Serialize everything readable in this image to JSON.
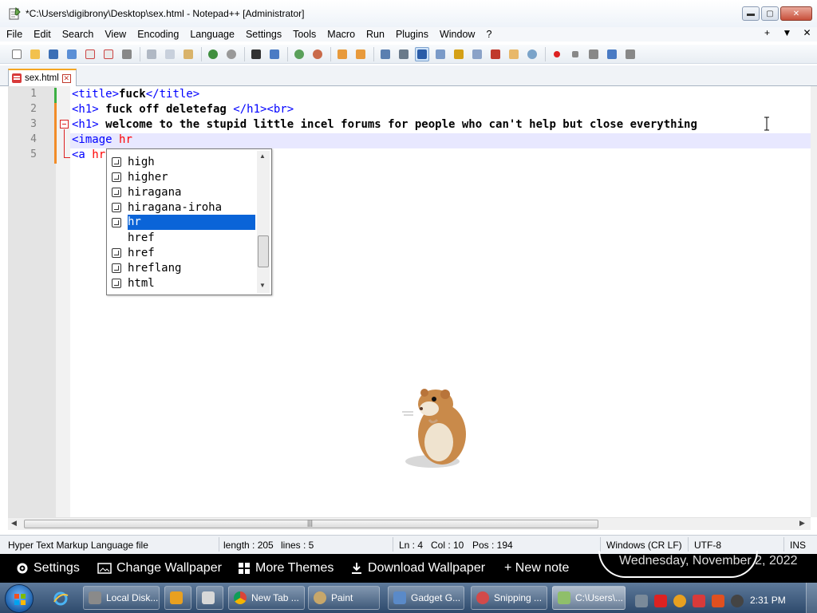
{
  "window": {
    "title": "*C:\\Users\\digibrony\\Desktop\\sex.html - Notepad++ [Administrator]",
    "minimize": "▬",
    "maximize": "▢",
    "close": "✕"
  },
  "menu": {
    "items": [
      "File",
      "Edit",
      "Search",
      "View",
      "Encoding",
      "Language",
      "Settings",
      "Tools",
      "Macro",
      "Run",
      "Plugins",
      "Window",
      "?"
    ],
    "right": [
      "+",
      "▼",
      "✕"
    ]
  },
  "tab": {
    "label": "sex.html",
    "close": "✕"
  },
  "editor": {
    "line_numbers": [
      "1",
      "2",
      "3",
      "4",
      "5"
    ],
    "lines": {
      "l1": {
        "t1": "<title>",
        "t2": "fuck",
        "t3": "</title>"
      },
      "l2": {
        "t1": "<h1>",
        "t2": " fuck off deletefag ",
        "t3": "</h1><br>"
      },
      "l3": {
        "t1": "<h1>",
        "t2": " welcome to the stupid little incel forums for people who can't help but close everything"
      },
      "l4": {
        "t1": "<image ",
        "t2": "hr"
      },
      "l5": {
        "t1": "<a ",
        "t2": "hr"
      }
    }
  },
  "autocomplete": {
    "items": [
      "high",
      "higher",
      "hiragana",
      "hiragana-iroha",
      "hr",
      "href",
      "href",
      "hreflang",
      "html"
    ],
    "up": "▲",
    "down": "▼"
  },
  "hscroll": {
    "left": "◀",
    "grip": "|||",
    "right": "▶"
  },
  "status": {
    "file_type": "Hyper Text Markup Language file",
    "length": "length : 205",
    "lines": "lines : 5",
    "ln": "Ln : 4",
    "col": "Col : 10",
    "pos": "Pos : 194",
    "eol": "Windows (CR LF)",
    "encoding": "UTF-8",
    "mode": "INS"
  },
  "gadget_bar": {
    "settings": "Settings",
    "change_wallpaper": "Change Wallpaper",
    "more_themes": "More Themes",
    "download_wallpaper": "Download Wallpaper",
    "new_note": "+ New note",
    "date": "Wednesday, November 2, 2022"
  },
  "taskbar": {
    "buttons": [
      "Local Disk...",
      "New Tab ...",
      "Paint",
      "Gadget G...",
      "Snipping ...",
      "C:\\Users\\..."
    ],
    "clock": "2:31 PM"
  }
}
